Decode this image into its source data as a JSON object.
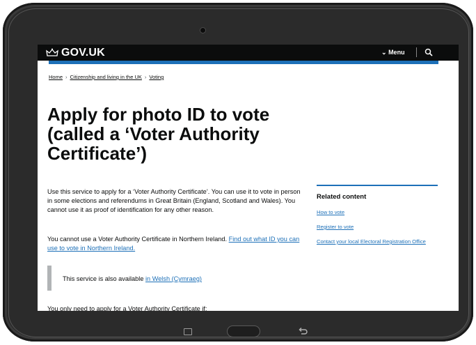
{
  "header": {
    "logo_text": "GOV.UK",
    "menu_label": "Menu",
    "accent_color": "#1d70b8"
  },
  "breadcrumbs": [
    "Home",
    "Citizenship and living in the UK",
    "Voting"
  ],
  "title": {
    "line1": "Apply for photo ID to vote",
    "line2": "(called a ‘Voter Authority",
    "line3": "Certificate’)"
  },
  "intro": "Use this service to apply for a ‘Voter Authority Certificate’. You can use it to vote in person in some elections and referendums in Great Britain (England, Scotland and Wales). You cannot use it as proof of identification for any other reason.",
  "northern_ireland": {
    "text": "You cannot use a Voter Authority Certificate in Northern Ireland. ",
    "link": "Find out what ID you can use to vote in Northern Ireland."
  },
  "welsh": {
    "text": "This service is also available ",
    "link": "in Welsh (Cymraeg)"
  },
  "eligibility_intro": "You only need to apply for a Voter Authority Certificate if:",
  "related": {
    "title": "Related content",
    "links": [
      "How to vote",
      "Register to vote",
      "Contact your local Electoral Registration Office"
    ]
  },
  "icons": {
    "logo": "crown-icon",
    "menu": "chevron-down-icon",
    "search": "search-icon",
    "recent_apps": "recent-apps-icon",
    "back": "back-icon"
  }
}
